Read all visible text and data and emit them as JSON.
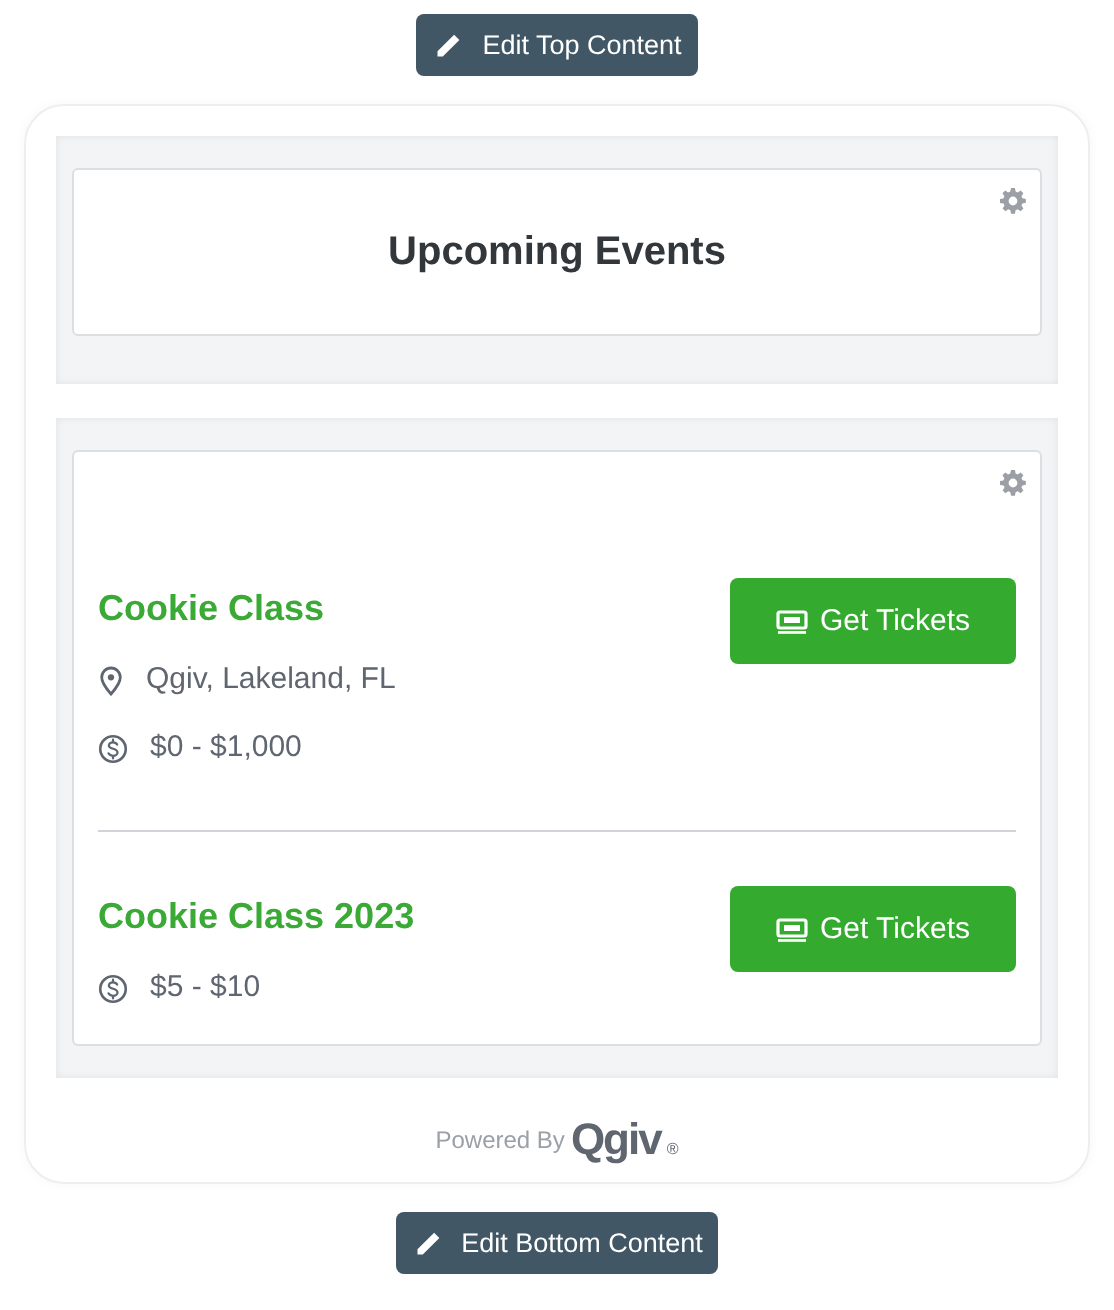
{
  "top_button": {
    "label": "Edit Top Content"
  },
  "header": {
    "title": "Upcoming Events"
  },
  "events": [
    {
      "name": "Cookie Class",
      "button": "Get Tickets",
      "details": [
        {
          "kind": "location",
          "text": "Qgiv, Lakeland, FL"
        },
        {
          "kind": "price",
          "text": "$0 - $1,000"
        }
      ]
    },
    {
      "name": "Cookie Class 2023",
      "button": "Get Tickets",
      "details": [
        {
          "kind": "price",
          "text": "$5 - $10"
        }
      ]
    }
  ],
  "footer": {
    "powered_by": "Powered By",
    "logo": "Qgiv",
    "logo_mark": "®"
  },
  "bottom_button": {
    "label": "Edit Bottom Content"
  }
}
